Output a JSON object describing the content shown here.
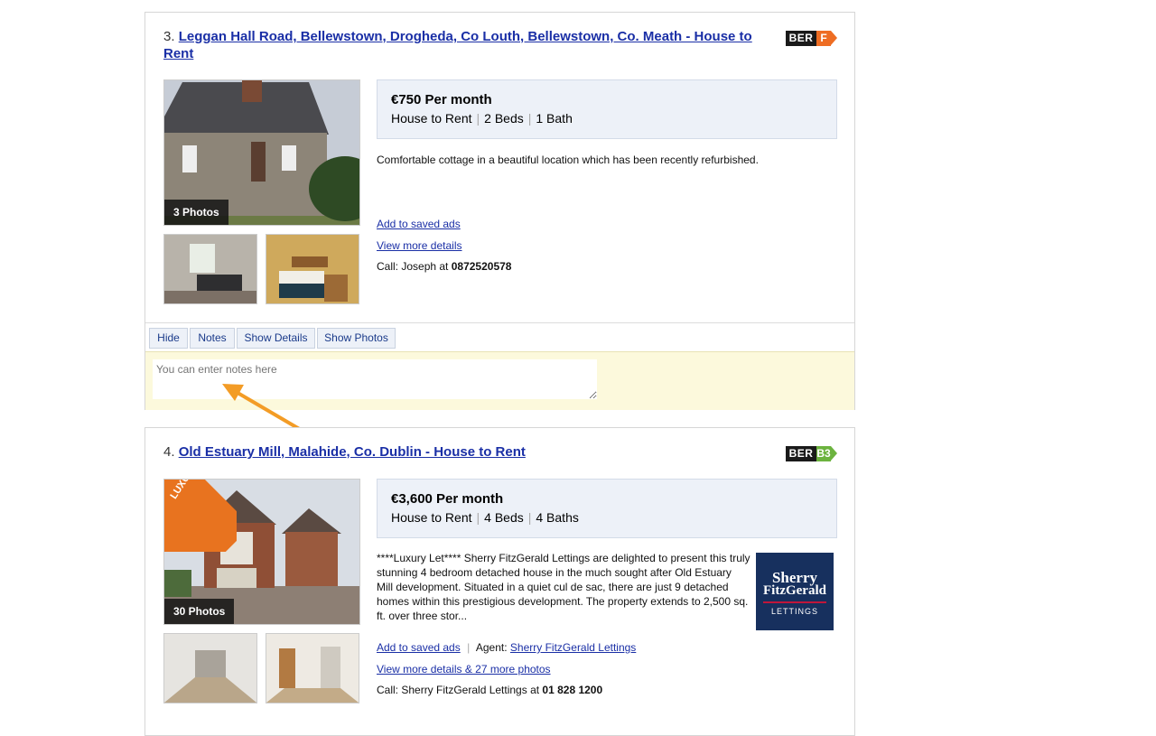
{
  "listings": [
    {
      "index": "3.",
      "title": "Leggan Hall Road, Bellewstown, Drogheda, Co Louth, Bellewstown, Co. Meath - House to Rent",
      "ber": {
        "label": "BER",
        "grade": "F",
        "color": "#ee6d23"
      },
      "photo_count": "3 Photos",
      "price": "€750 Per month",
      "type": "House to Rent",
      "beds": "2 Beds",
      "baths": "1 Bath",
      "description": "Comfortable cottage in a beautiful location which has been recently refurbished.",
      "save_label": "Add to saved ads",
      "details_label": "View more details",
      "call_prefix": "Call: Joseph at",
      "phone": "0872520578",
      "buttons": {
        "hide": "Hide",
        "notes": "Notes",
        "show_details": "Show Details",
        "show_photos": "Show Photos"
      },
      "notes_placeholder": "You can enter notes here"
    },
    {
      "index": "4.",
      "title": "Old Estuary Mill, Malahide, Co. Dublin - House to Rent",
      "ber": {
        "label": "BER",
        "grade": "B3",
        "color": "#6cb33f"
      },
      "badge": "LUXURY LET",
      "photo_count": "30 Photos",
      "price": "€3,600 Per month",
      "type": "House to Rent",
      "beds": "4 Beds",
      "baths": "4 Baths",
      "description": "****Luxury Let**** Sherry FitzGerald Lettings are delighted to present this truly stunning 4 bedroom detached house in the much sought after Old Estuary Mill development. Situated in a quiet cul de sac, there are just 9 detached homes within this prestigious development. The property extends to 2,500 sq. ft. over three stor...",
      "save_label": "Add to saved ads",
      "agent_prefix": "Agent:",
      "agent_name": "Sherry FitzGerald Lettings",
      "details_label": "View more details & 27 more photos",
      "call_prefix": "Call: Sherry FitzGerald Lettings at",
      "phone": "01 828 1200",
      "agent_logo": {
        "line1": "Sherry",
        "line2": "FitzGerald",
        "line3": "LETTINGS"
      }
    }
  ],
  "colors": {
    "link": "#1a2fa6",
    "notes_bg": "#fcf9dc",
    "infobox_bg": "#edf1f8",
    "arrow": "#f39c26"
  }
}
